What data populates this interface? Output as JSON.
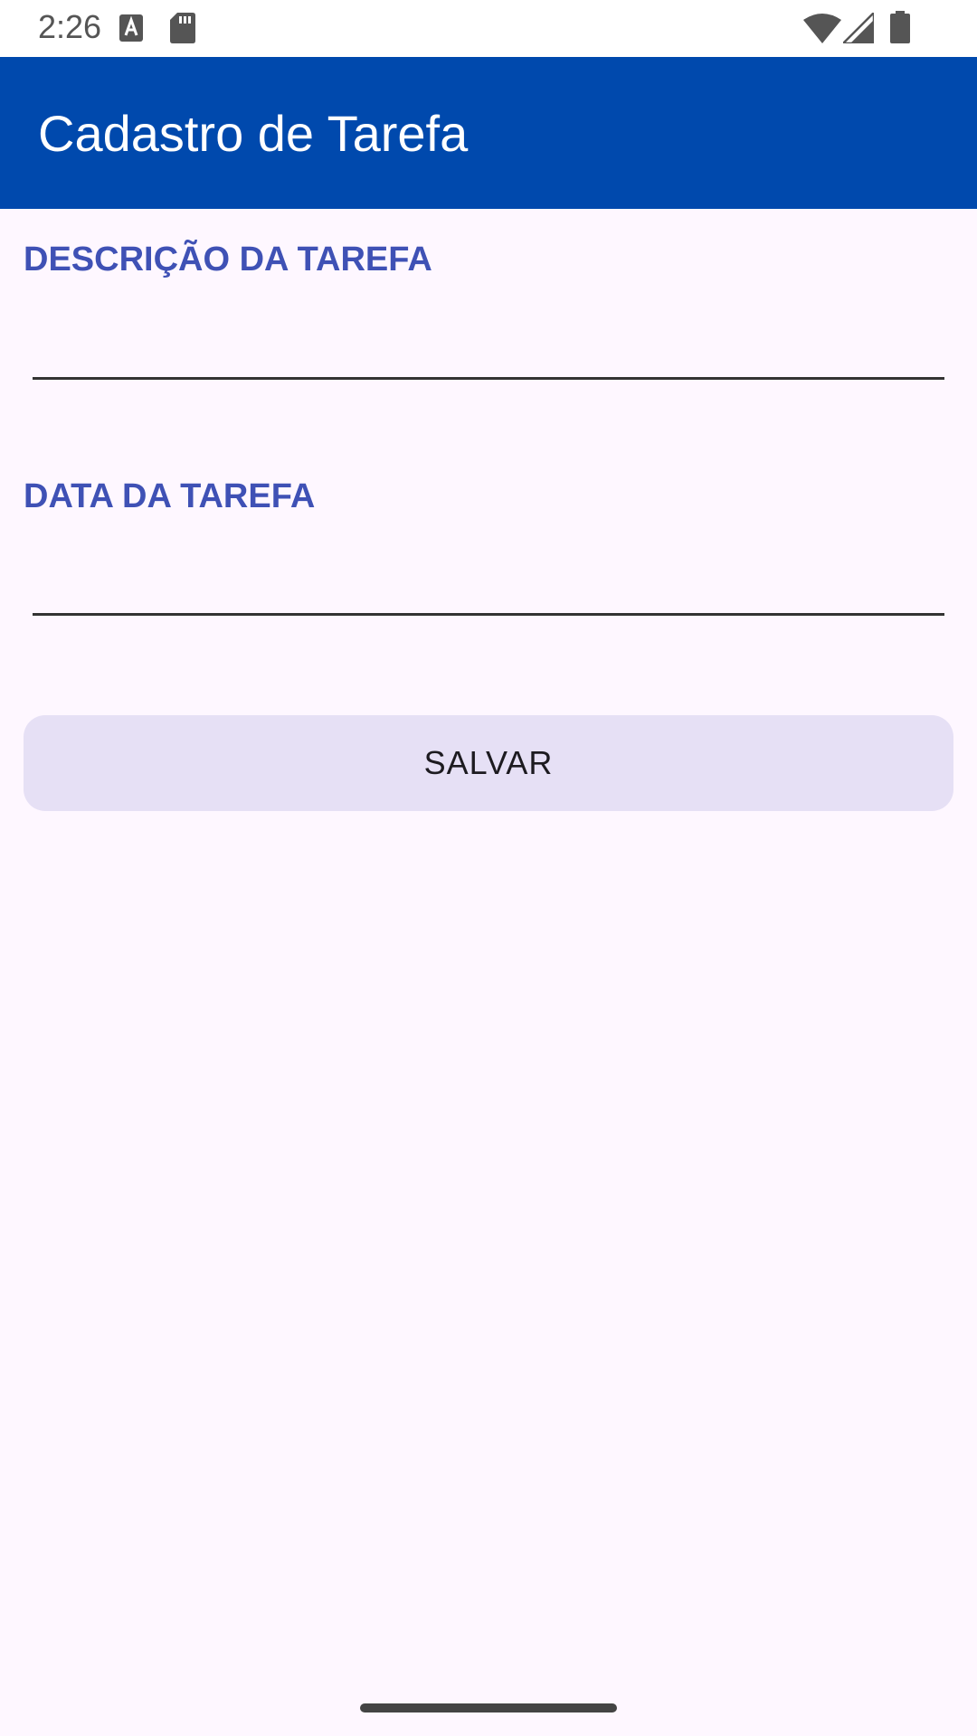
{
  "status_bar": {
    "time": "2:26",
    "icons": [
      "text-a-icon",
      "sd-card-icon",
      "wifi-icon",
      "signal-icon",
      "battery-icon"
    ]
  },
  "app_bar": {
    "title": "Cadastro de Tarefa",
    "color": "#0049AD"
  },
  "form": {
    "description": {
      "label": "DESCRIÇÃO DA TAREFA",
      "value": ""
    },
    "date": {
      "label": "DATA DA TAREFA",
      "value": ""
    },
    "save_label": "SALVAR",
    "label_color": "#3F51B5",
    "button_color": "#E6E0F5"
  }
}
